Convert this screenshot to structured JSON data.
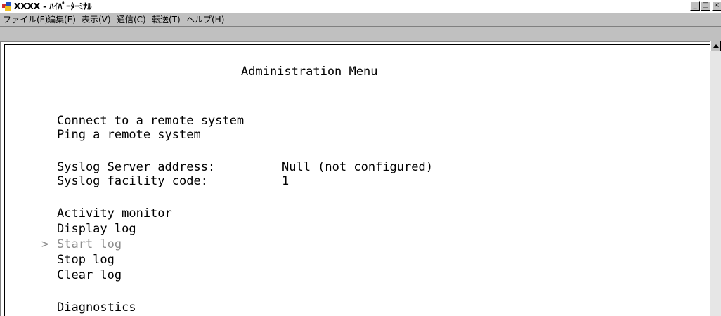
{
  "window": {
    "title": "XXXX - ﾊｲﾊﾟｰﾀｰﾐﾅﾙ",
    "app_icon": "hyperterminal-icon",
    "controls": {
      "minimize": "_",
      "maximize": "□",
      "close": "×"
    }
  },
  "menubar": {
    "items": [
      {
        "label": "ファイル(F)"
      },
      {
        "label": "編集(E)"
      },
      {
        "label": "表示(V)"
      },
      {
        "label": "通信(C)"
      },
      {
        "label": "転送(T)"
      },
      {
        "label": "ヘルプ(H)"
      }
    ]
  },
  "terminal": {
    "heading": "Administration Menu",
    "connect": "Connect to a remote system",
    "ping": "Ping a remote system",
    "syslog_server_label": "Syslog Server address:",
    "syslog_server_value": "Null (not configured)",
    "syslog_facility_label": "Syslog facility code:",
    "syslog_facility_value": "1",
    "activity_monitor": "Activity monitor",
    "display_log": "Display log",
    "cursor": ">",
    "start_log": "Start log",
    "stop_log": "Stop log",
    "clear_log": "Clear log",
    "diagnostics": "Diagnostics"
  },
  "colors": {
    "selected_text": "#8c8c8c",
    "terminal_bg": "#ffffff",
    "chrome": "#c0c0c0"
  },
  "scrollbar": {
    "up_arrow": "scroll-up-arrow-icon"
  }
}
